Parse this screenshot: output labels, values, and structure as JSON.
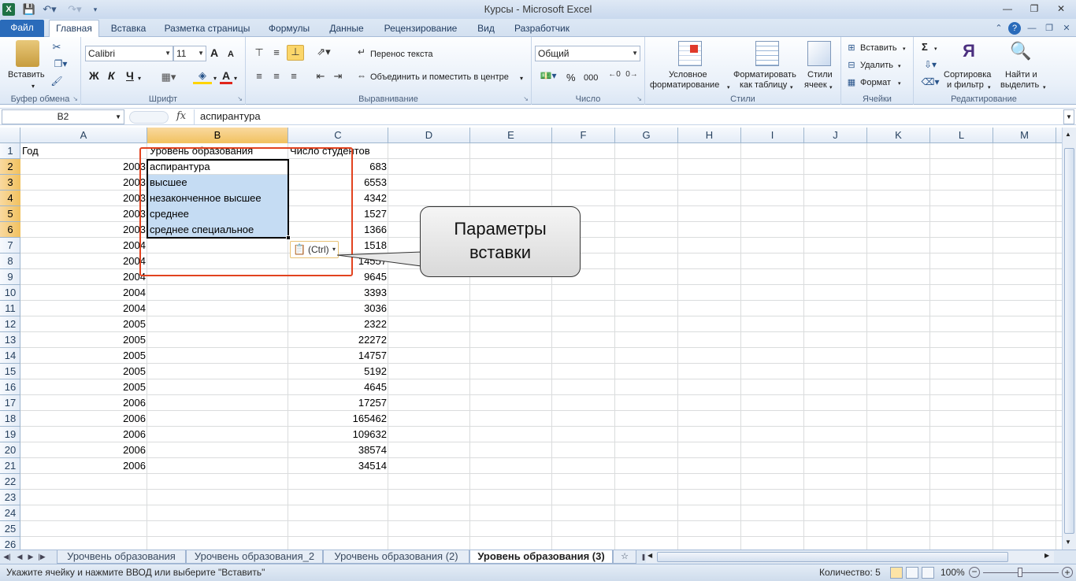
{
  "window": {
    "title": "Курсы  -  Microsoft Excel",
    "app_icon": "X",
    "quick_access": [
      "save-icon",
      "undo-icon",
      "redo-icon",
      "customize-icon"
    ]
  },
  "tabs": {
    "file": "Файл",
    "items": [
      "Главная",
      "Вставка",
      "Разметка страницы",
      "Формулы",
      "Данные",
      "Рецензирование",
      "Вид",
      "Разработчик"
    ],
    "active": "Главная"
  },
  "ribbon": {
    "clipboard": {
      "paste": "Вставить",
      "label": "Буфер обмена"
    },
    "font": {
      "name": "Calibri",
      "size": "11",
      "bold": "Ж",
      "italic": "К",
      "underline": "Ч",
      "grow": "A",
      "shrink": "A",
      "label": "Шрифт"
    },
    "alignment": {
      "wrap": "Перенос текста",
      "merge": "Объединить и поместить в центре",
      "label": "Выравнивание"
    },
    "number": {
      "format": "Общий",
      "percent": "%",
      "thousands": "000",
      "label": "Число"
    },
    "styles": {
      "conditional_1": "Условное",
      "conditional_2": "форматирование",
      "table_1": "Форматировать",
      "table_2": "как таблицу",
      "cell_1": "Стили",
      "cell_2": "ячеек",
      "label": "Стили"
    },
    "cells": {
      "insert": "Вставить",
      "delete": "Удалить",
      "format": "Формат",
      "label": "Ячейки"
    },
    "editing": {
      "sigma": "Σ",
      "sort_1": "Сортировка",
      "sort_2": "и фильтр",
      "find_1": "Найти и",
      "find_2": "выделить",
      "label": "Редактирование"
    }
  },
  "formula_bar": {
    "name_box": "B2",
    "fx": "fx",
    "value": "аспирантура"
  },
  "columns": [
    "A",
    "B",
    "C",
    "D",
    "E",
    "F",
    "G",
    "H",
    "I",
    "J",
    "K",
    "L",
    "M"
  ],
  "rows": [
    "1",
    "2",
    "3",
    "4",
    "5",
    "6",
    "7",
    "8",
    "9",
    "10",
    "11",
    "12",
    "13",
    "14",
    "15",
    "16",
    "17",
    "18",
    "19",
    "20",
    "21",
    "22",
    "23",
    "24",
    "25",
    "26"
  ],
  "cells": {
    "A1": "Год",
    "B1": "Уровень образования",
    "C1": "Число студентов",
    "A": [
      "2003",
      "2003",
      "2003",
      "2003",
      "2003",
      "2004",
      "2004",
      "2004",
      "2004",
      "2004",
      "2005",
      "2005",
      "2005",
      "2005",
      "2005",
      "2006",
      "2006",
      "2006",
      "2006",
      "2006"
    ],
    "B": [
      "аспирантура",
      "высшее",
      "незаконченное высшее",
      "среднее",
      "среднее специальное"
    ],
    "C": [
      "683",
      "6553",
      "4342",
      "1527",
      "1366",
      "1518",
      "14557",
      "9645",
      "3393",
      "3036",
      "2322",
      "22272",
      "14757",
      "5192",
      "4645",
      "17257",
      "165462",
      "109632",
      "38574",
      "34514"
    ]
  },
  "paste_options": {
    "label": "(Ctrl)"
  },
  "callout": {
    "line1": "Параметры",
    "line2": "вставки"
  },
  "sheets": [
    "Урочвень образования",
    "Урочвень образования_2",
    "Урочвень образования (2)",
    "Уровень образования (3)"
  ],
  "active_sheet": "Уровень образования (3)",
  "status": {
    "message": "Укажите ячейку и нажмите ВВОД или выберите \"Вставить\"",
    "count": "Количество: 5",
    "zoom": "100%"
  }
}
